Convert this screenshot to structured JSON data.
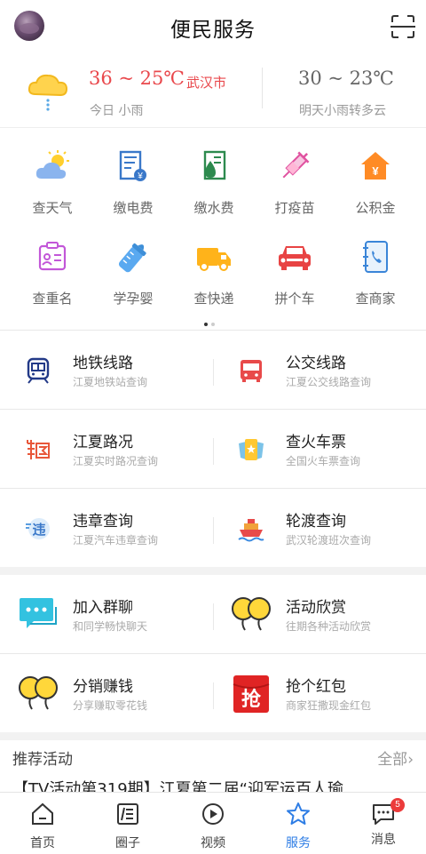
{
  "header": {
    "title": "便民服务"
  },
  "weather": {
    "today_temp": "36 ~ 25℃",
    "city": "武汉市",
    "today_desc": "今日 小雨",
    "tomorrow_temp": "30 ~ 23℃",
    "tomorrow_desc": "明天小雨转多云"
  },
  "grid": [
    {
      "label": "查天气",
      "icon": "weather-icon"
    },
    {
      "label": "缴电费",
      "icon": "electric-bill-icon"
    },
    {
      "label": "缴水费",
      "icon": "water-bill-icon"
    },
    {
      "label": "打疫苗",
      "icon": "vaccine-icon"
    },
    {
      "label": "公积金",
      "icon": "housing-fund-icon"
    },
    {
      "label": "查重名",
      "icon": "name-check-icon"
    },
    {
      "label": "学孕婴",
      "icon": "baby-bottle-icon"
    },
    {
      "label": "查快递",
      "icon": "delivery-truck-icon"
    },
    {
      "label": "拼个车",
      "icon": "carpool-icon"
    },
    {
      "label": "查商家",
      "icon": "merchant-phone-icon"
    }
  ],
  "services": [
    {
      "title": "地铁线路",
      "sub": "江夏地铁站查询",
      "icon": "metro-icon"
    },
    {
      "title": "公交线路",
      "sub": "江夏公交线路查询",
      "icon": "bus-icon"
    },
    {
      "title": "江夏路况",
      "sub": "江夏实时路况查询",
      "icon": "traffic-icon"
    },
    {
      "title": "查火车票",
      "sub": "全国火车票查询",
      "icon": "train-ticket-icon"
    },
    {
      "title": "违章查询",
      "sub": "江夏汽车违章查询",
      "icon": "violation-icon"
    },
    {
      "title": "轮渡查询",
      "sub": "武汉轮渡班次查询",
      "icon": "ferry-icon"
    },
    {
      "title": "加入群聊",
      "sub": "和同学畅快聊天",
      "icon": "group-chat-icon"
    },
    {
      "title": "活动欣赏",
      "sub": "往期各种活动欣赏",
      "icon": "balloons-icon"
    },
    {
      "title": "分销赚钱",
      "sub": "分享赚取零花钱",
      "icon": "balloons-icon"
    },
    {
      "title": "抢个红包",
      "sub": "商家狂撒现金红包",
      "icon": "red-packet-icon"
    }
  ],
  "red_packet_char": "抢",
  "recommend": {
    "title": "推荐活动",
    "all": "全部",
    "first_item": "【TV活动第319期】江夏第二届“迎军运百人瑜"
  },
  "tabs": [
    {
      "label": "首页",
      "icon": "home-icon"
    },
    {
      "label": "圈子",
      "icon": "circle-icon"
    },
    {
      "label": "视频",
      "icon": "play-icon"
    },
    {
      "label": "服务",
      "icon": "star-icon"
    },
    {
      "label": "消息",
      "icon": "message-icon"
    }
  ],
  "active_tab": "服务",
  "message_badge": "5",
  "colors": {
    "accent": "#2e7de5",
    "temp_red": "#e9484c",
    "badge_red": "#ec3b3b"
  }
}
